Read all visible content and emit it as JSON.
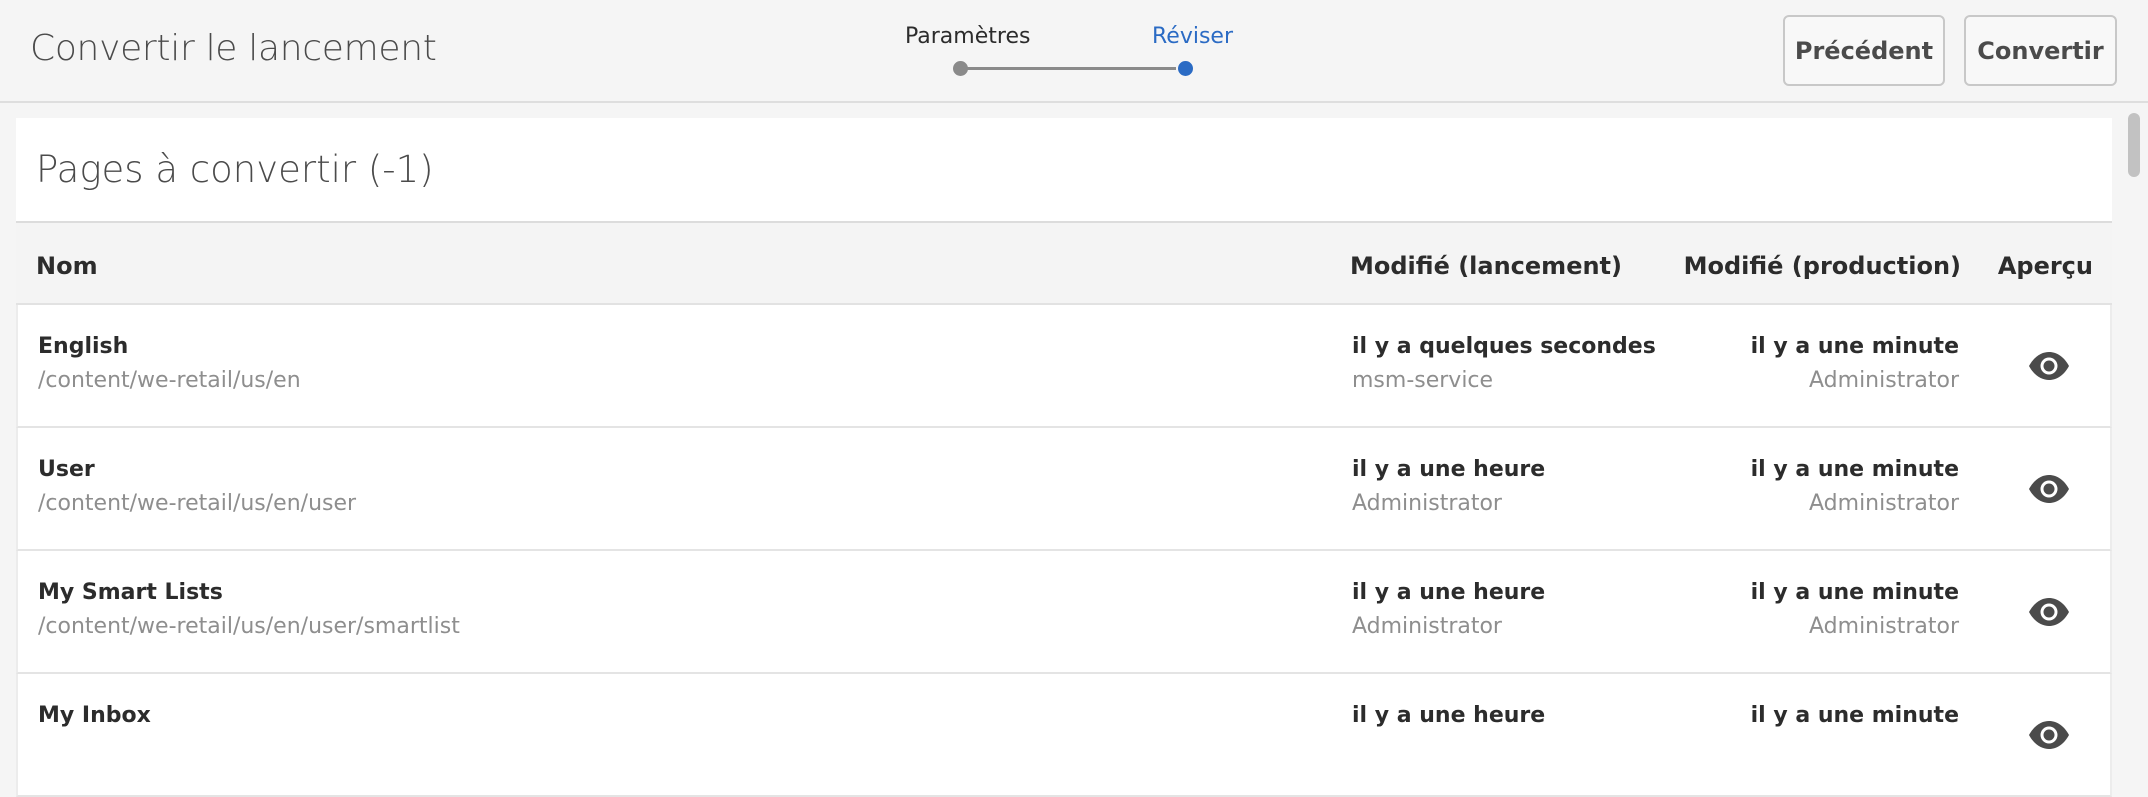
{
  "header": {
    "title": "Convertir le lancement",
    "steps": [
      {
        "label": "Paramètres"
      },
      {
        "label": "Réviser"
      }
    ],
    "buttons": {
      "previous": "Précédent",
      "convert": "Convertir"
    }
  },
  "panel": {
    "title": "Pages à convertir (-1)",
    "columns": {
      "name": "Nom",
      "modified_launch": "Modifié (lancement)",
      "modified_production": "Modifié (production)",
      "preview": "Aperçu"
    },
    "rows": [
      {
        "name": "English",
        "path": "/content/we-retail/us/en",
        "launch_time": "il y a quelques secondes",
        "launch_user": "msm-service",
        "prod_time": "il y a une minute",
        "prod_user": "Administrator"
      },
      {
        "name": "User",
        "path": "/content/we-retail/us/en/user",
        "launch_time": "il y a une heure",
        "launch_user": "Administrator",
        "prod_time": "il y a une minute",
        "prod_user": "Administrator"
      },
      {
        "name": "My Smart Lists",
        "path": "/content/we-retail/us/en/user/smartlist",
        "launch_time": "il y a une heure",
        "launch_user": "Administrator",
        "prod_time": "il y a une minute",
        "prod_user": "Administrator"
      },
      {
        "name": "My Inbox",
        "path": "",
        "launch_time": "il y a une heure",
        "launch_user": "",
        "prod_time": "il y a une minute",
        "prod_user": ""
      }
    ]
  },
  "icons": {
    "preview": "eye-icon"
  },
  "colors": {
    "accent": "#2b6bc4",
    "inactive_step": "#8a8a8a"
  }
}
